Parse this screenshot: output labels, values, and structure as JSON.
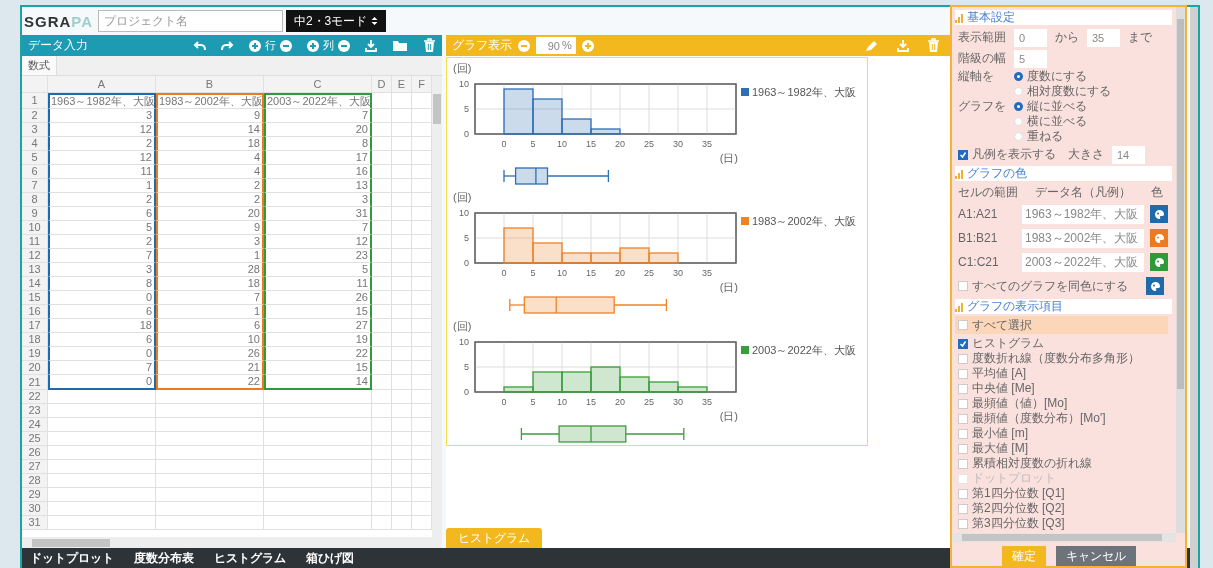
{
  "topbar": {
    "logo": {
      "main": "SGRA",
      "accent": "PA"
    },
    "project": {
      "placeholder": "プロジェクト名"
    },
    "mode": "中2・3モード"
  },
  "data_panel": {
    "title": "データ入力",
    "row_label": "行",
    "column_label": "列"
  },
  "sheet": {
    "formula_tab": "数式",
    "columns": [
      "A",
      "B",
      "C",
      "D",
      "E",
      "F"
    ],
    "rows": [
      {
        "number": "1",
        "cells": [
          "1963～1982年、大阪",
          "1983～2002年、大阪",
          "2003～2022年、大阪"
        ]
      },
      {
        "number": "2",
        "cells": [
          "3",
          "9",
          "7"
        ]
      },
      {
        "number": "3",
        "cells": [
          "12",
          "14",
          "20"
        ]
      },
      {
        "number": "4",
        "cells": [
          "2",
          "18",
          "8"
        ]
      },
      {
        "number": "5",
        "cells": [
          "12",
          "4",
          "17"
        ]
      },
      {
        "number": "6",
        "cells": [
          "11",
          "4",
          "16"
        ]
      },
      {
        "number": "7",
        "cells": [
          "1",
          "2",
          "13"
        ]
      },
      {
        "number": "8",
        "cells": [
          "2",
          "2",
          "3"
        ]
      },
      {
        "number": "9",
        "cells": [
          "6",
          "20",
          "31"
        ]
      },
      {
        "number": "10",
        "cells": [
          "5",
          "9",
          "7"
        ]
      },
      {
        "number": "11",
        "cells": [
          "2",
          "3",
          "12"
        ]
      },
      {
        "number": "12",
        "cells": [
          "7",
          "1",
          "23"
        ]
      },
      {
        "number": "13",
        "cells": [
          "3",
          "28",
          "5"
        ]
      },
      {
        "number": "14",
        "cells": [
          "8",
          "18",
          "11"
        ]
      },
      {
        "number": "15",
        "cells": [
          "0",
          "7",
          "26"
        ]
      },
      {
        "number": "16",
        "cells": [
          "6",
          "1",
          "15"
        ]
      },
      {
        "number": "17",
        "cells": [
          "18",
          "6",
          "27"
        ]
      },
      {
        "number": "18",
        "cells": [
          "6",
          "10",
          "19"
        ]
      },
      {
        "number": "19",
        "cells": [
          "0",
          "26",
          "22"
        ]
      },
      {
        "number": "20",
        "cells": [
          "7",
          "21",
          "15"
        ]
      },
      {
        "number": "21",
        "cells": [
          "0",
          "22",
          "14"
        ]
      },
      {
        "number": "22"
      },
      {
        "number": "23"
      },
      {
        "number": "24"
      },
      {
        "number": "25"
      },
      {
        "number": "26"
      },
      {
        "number": "27"
      },
      {
        "number": "28"
      },
      {
        "number": "29"
      },
      {
        "number": "30"
      },
      {
        "number": "31"
      }
    ]
  },
  "bottom_tabs": [
    "ドットプロット",
    "度数分布表",
    "ヒストグラム",
    "箱ひげ図"
  ],
  "graph_panel": {
    "title": "グラフ表示",
    "zoom": "90",
    "zoom_unit": "%",
    "charts": [
      {
        "chart_data": {
          "type": "bar",
          "grid": true,
          "ylabel": "(回)",
          "xlabel": "(日)",
          "x": [
            2.5,
            7.5,
            12.5,
            17.5
          ],
          "xlim": [
            -5,
            40
          ],
          "ylim": [
            0,
            10
          ],
          "xticks": [
            0,
            5,
            10,
            15,
            20,
            25,
            30,
            35
          ],
          "yticks": [
            0,
            5,
            10
          ],
          "series": [
            {
              "name": "1963～1982年、大阪",
              "color": "#2f6fb5",
              "values": [
                9,
                7,
                3,
                1
              ]
            }
          ]
        }
      },
      {
        "chart_data": {
          "type": "bar",
          "grid": true,
          "ylabel": "(回)",
          "xlabel": "(日)",
          "x": [
            2.5,
            7.5,
            12.5,
            17.5,
            22.5,
            27.5
          ],
          "xlim": [
            -5,
            40
          ],
          "ylim": [
            0,
            10
          ],
          "xticks": [
            0,
            5,
            10,
            15,
            20,
            25,
            30,
            35
          ],
          "yticks": [
            0,
            5,
            10
          ],
          "series": [
            {
              "name": "1983～2002年、大阪",
              "color": "#f08227",
              "values": [
                7,
                4,
                2,
                2,
                3,
                2
              ]
            }
          ]
        }
      },
      {
        "chart_data": {
          "type": "bar",
          "grid": true,
          "ylabel": "(回)",
          "xlabel": "(日)",
          "x": [
            2.5,
            7.5,
            12.5,
            17.5,
            22.5,
            27.5,
            32.5
          ],
          "xlim": [
            -5,
            40
          ],
          "ylim": [
            0,
            10
          ],
          "xticks": [
            0,
            5,
            10,
            15,
            20,
            25,
            30,
            35
          ],
          "yticks": [
            0,
            5,
            10
          ],
          "series": [
            {
              "name": "2003～2022年、大阪",
              "color": "#3a9e3a",
              "values": [
                1,
                4,
                4,
                5,
                3,
                2,
                1
              ]
            }
          ]
        }
      }
    ],
    "tabs": [
      {
        "label": "ヒストグラム",
        "selected": true
      }
    ]
  },
  "settings": {
    "basic": {
      "title": "基本設定",
      "range": {
        "label": "表示範囲",
        "from": "0",
        "from_unit": "から",
        "to": "35",
        "to_unit": "まで"
      },
      "class_width": {
        "label": "階級の幅",
        "value": "5"
      },
      "vertical_axis": {
        "label": "縦軸を",
        "options": [
          {
            "label": "度数にする",
            "selected": true
          },
          {
            "label": "相対度数にする",
            "selected": false
          }
        ]
      },
      "arrangement": {
        "label": "グラフを",
        "options": [
          {
            "label": "縦に並べる",
            "selected": true
          },
          {
            "label": "横に並べる",
            "selected": false
          },
          {
            "label": "重ねる",
            "selected": false
          }
        ]
      },
      "legend": {
        "label": "凡例を表示する",
        "checked": true,
        "size_label": "大きさ",
        "size": "14"
      }
    },
    "colors": {
      "title": "グラフの色",
      "columns": [
        "セルの範囲",
        "データ名（凡例）",
        "色"
      ],
      "rows": [
        {
          "range": "A1:A21",
          "name": "1963～1982年、大阪",
          "color": "#1d6aad"
        },
        {
          "range": "B1:B21",
          "name": "1983～2002年、大阪",
          "color": "#ee7a1f"
        },
        {
          "range": "C1:C21",
          "name": "2003～2022年、大阪",
          "color": "#2e9b3a"
        }
      ],
      "same_color": {
        "label": "すべてのグラフを同色にする",
        "checked": false,
        "color": "#1d6aad"
      }
    },
    "items": {
      "title": "グラフの表示項目",
      "select_all": {
        "label": "すべて選択",
        "checked": false
      },
      "options": [
        {
          "label": "ヒストグラム",
          "checked": true,
          "disabled": false
        },
        {
          "label": "度数折れ線（度数分布多角形）",
          "checked": false,
          "disabled": false
        },
        {
          "label": "平均値 [A]",
          "checked": false,
          "disabled": false
        },
        {
          "label": "中央値 [Me]",
          "checked": false,
          "disabled": false
        },
        {
          "label": "最頻値（値）[Mo]",
          "checked": false,
          "disabled": false
        },
        {
          "label": "最頻値（度数分布）[Mo']",
          "checked": false,
          "disabled": false
        },
        {
          "label": "最小値 [m]",
          "checked": false,
          "disabled": false
        },
        {
          "label": "最大値 [M]",
          "checked": false,
          "disabled": false
        },
        {
          "label": "累積相対度数の折れ線",
          "checked": false,
          "disabled": false
        },
        {
          "label": "ドットプロット",
          "checked": false,
          "disabled": true
        },
        {
          "label": "第1四分位数 [Q1]",
          "checked": false,
          "disabled": false
        },
        {
          "label": "第2四分位数 [Q2]",
          "checked": false,
          "disabled": false
        },
        {
          "label": "第3四分位数 [Q3]",
          "checked": false,
          "disabled": false
        }
      ]
    },
    "buttons": [
      {
        "label": "確定",
        "kind": "primary"
      },
      {
        "label": "キャンセル",
        "kind": "secondary"
      }
    ]
  }
}
